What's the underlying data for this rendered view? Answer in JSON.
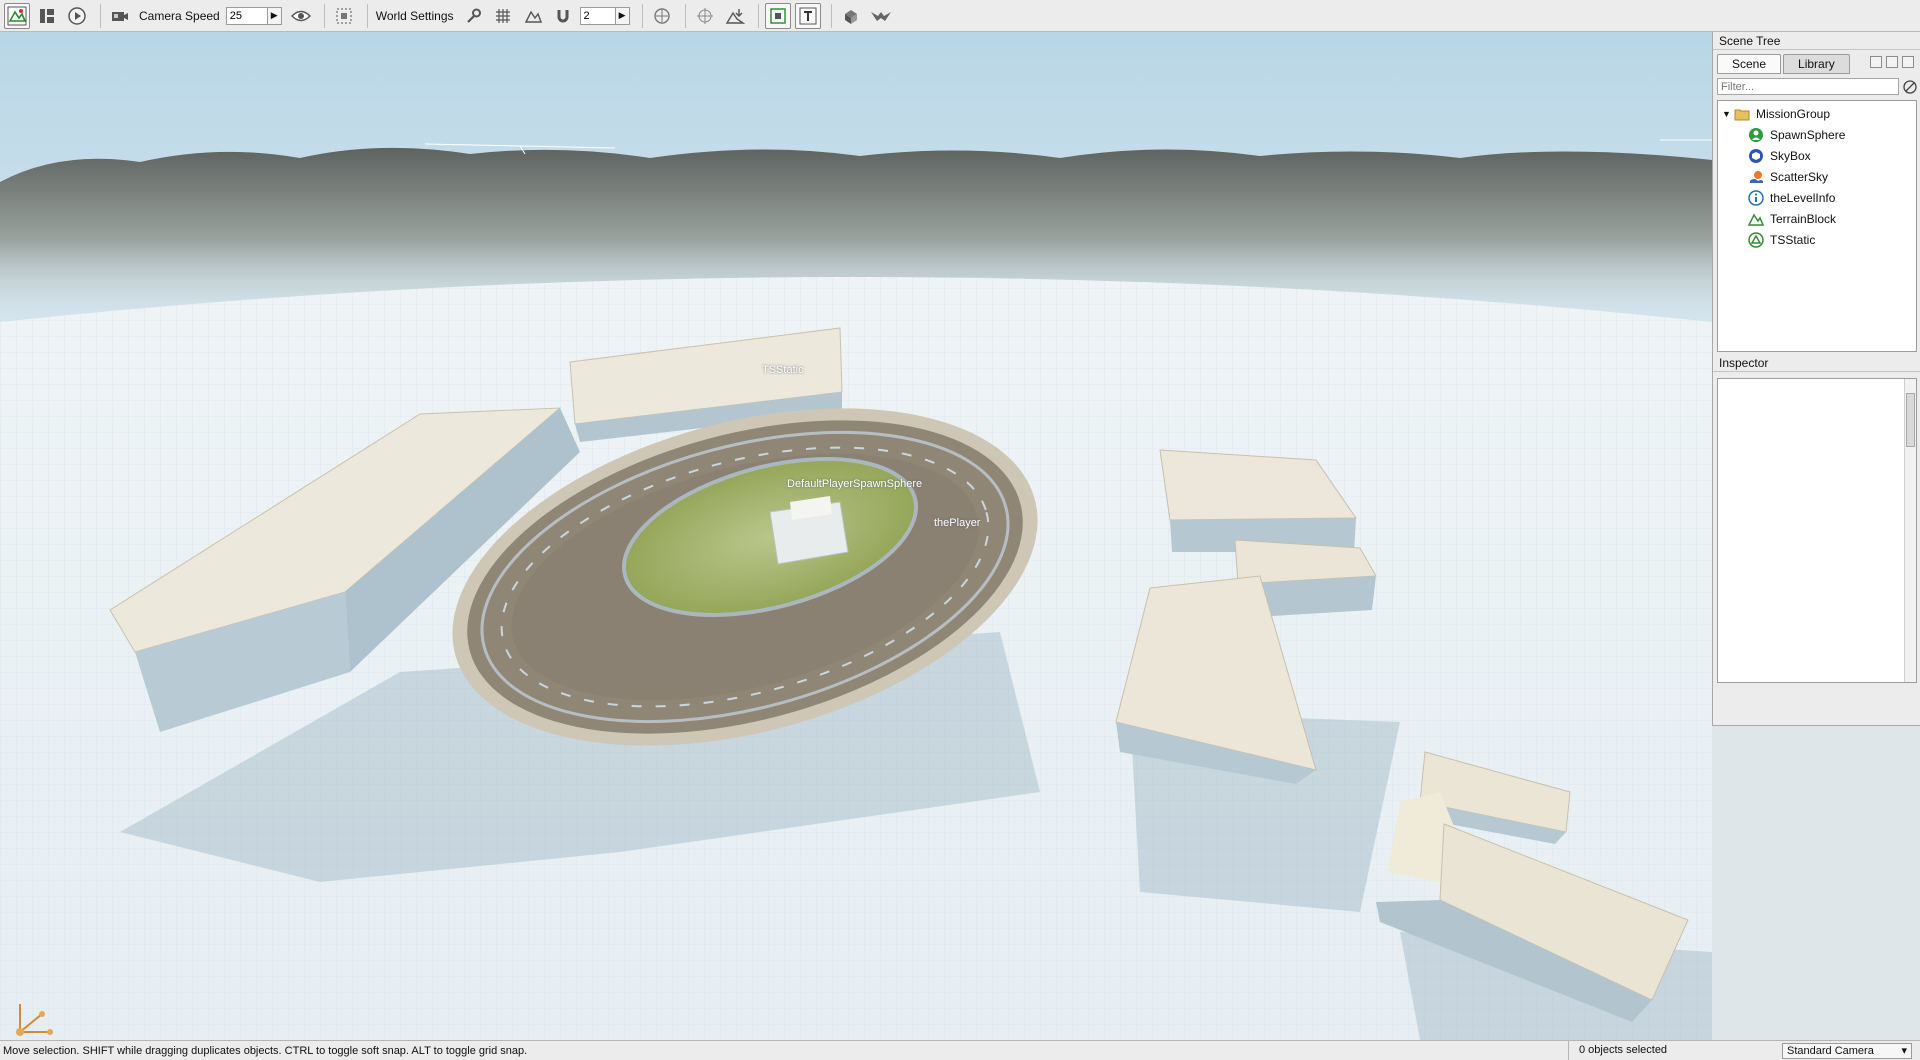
{
  "toolbar": {
    "camera_speed_label": "Camera Speed",
    "camera_speed_value": "25",
    "world_settings_label": "World Settings",
    "snap_value": "2"
  },
  "icons": {
    "top_left": [
      "world-editor-icon",
      "layout-icon",
      "play-icon"
    ],
    "palette": [
      "object-editor-icon",
      "terrain-editor-icon",
      "terrain-painter-icon",
      "material-editor-icon",
      "mesh-road-icon",
      "decal-editor-icon",
      "forest-editor-icon",
      "river-editor-icon",
      "road-editor-icon",
      "navmesh-editor-icon",
      "particle-editor-icon",
      "datablock-editor-icon",
      "shape-editor-icon",
      "gui-editor-icon"
    ],
    "left_tools": [
      "select-arrow-icon",
      "move-gizmo-icon",
      "rotate-gizmo-icon",
      "scale-gizmo-icon"
    ]
  },
  "scene_labels": {
    "tsstatic": "TSStatic",
    "spawn_overlap": "DefaultPlayerSpawnSphere",
    "player": "thePlayer"
  },
  "scene_tree": {
    "title": "Scene Tree",
    "tabs": [
      "Scene",
      "Library"
    ],
    "filter_placeholder": "Filter...",
    "root": "MissionGroup",
    "items": [
      {
        "label": "SpawnSphere",
        "icon": "spawn-sphere-icon",
        "color": "#2e9c3a"
      },
      {
        "label": "SkyBox",
        "icon": "skybox-icon",
        "color": "#2a56b8"
      },
      {
        "label": "ScatterSky",
        "icon": "scatter-sky-icon",
        "color": "#d0631c"
      },
      {
        "label": "theLevelInfo",
        "icon": "level-info-icon",
        "color": "#2a6fc4"
      },
      {
        "label": "TerrainBlock",
        "icon": "terrain-block-icon",
        "color": "#3a8a3a"
      },
      {
        "label": "TSStatic",
        "icon": "tsstatic-icon",
        "color": "#3a8a3a"
      }
    ]
  },
  "inspector": {
    "title": "Inspector"
  },
  "status": {
    "text": "Move selection.  SHIFT while dragging duplicates objects.  CTRL to toggle soft snap.  ALT to toggle grid snap.",
    "selected_count": "0 objects selected",
    "camera_mode": "Standard Camera"
  }
}
